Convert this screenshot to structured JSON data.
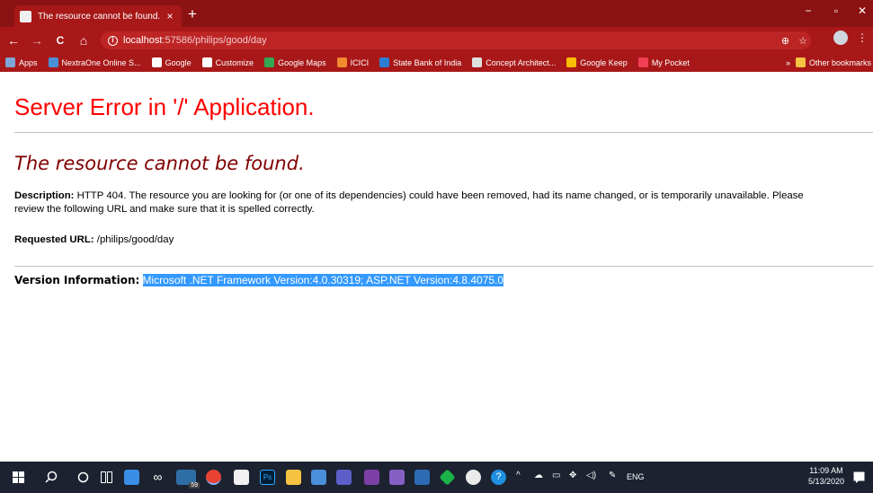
{
  "browser": {
    "tab_title": "The resource cannot be found.",
    "tab_close": "×",
    "new_tab": "+",
    "window_controls": {
      "minimize": "−",
      "restore": "▫",
      "close": "✕"
    },
    "nav": {
      "back": "←",
      "forward": "→",
      "reload": "C",
      "home": "⌂"
    },
    "url_host": "localhost",
    "url_path": ":57586/philips/good/day",
    "omnibox_icons": {
      "zoom": "⊕",
      "star": "☆"
    },
    "menu": "⋮",
    "bookmarks": [
      {
        "label": "Apps",
        "color": "#7ea7d8"
      },
      {
        "label": "NextraOne Online S...",
        "color": "#4a90d9"
      },
      {
        "label": "Google",
        "color": "#ffffff"
      },
      {
        "label": "Customize",
        "color": "#ffffff"
      },
      {
        "label": "Google Maps",
        "color": "#34a853"
      },
      {
        "label": "ICICI",
        "color": "#f28b30"
      },
      {
        "label": "State Bank of India",
        "color": "#2a7fd4"
      },
      {
        "label": "Concept Architect...",
        "color": "#e0e0e0"
      },
      {
        "label": "Google Keep",
        "color": "#fbbc04"
      },
      {
        "label": "My Pocket",
        "color": "#ef4056"
      }
    ],
    "bookmarks_overflow": "»",
    "other_bookmarks": "Other bookmarks"
  },
  "page": {
    "heading": "Server Error in '/' Application.",
    "subheading": "The resource cannot be found.",
    "description_label": "Description:",
    "description_text": "HTTP 404. The resource you are looking for (or one of its dependencies) could have been removed, had its name changed, or is temporarily unavailable.  Please review the following URL and make sure that it is spelled correctly.",
    "requested_url_label": "Requested URL:",
    "requested_url": "/philips/good/day",
    "version_label": "Version Information:",
    "version_text": "Microsoft .NET Framework Version:4.0.30319; ASP.NET Version:4.8.4075.0"
  },
  "taskbar": {
    "badge": "59",
    "language": "ENG",
    "time": "11:09 AM",
    "date": "5/13/2020",
    "colors": {
      "accent": "#0078d7",
      "chrome": "#e94235",
      "photoshop": "#31a8ff",
      "vs": "#865fc5",
      "teams": "#5b5fc7"
    }
  }
}
